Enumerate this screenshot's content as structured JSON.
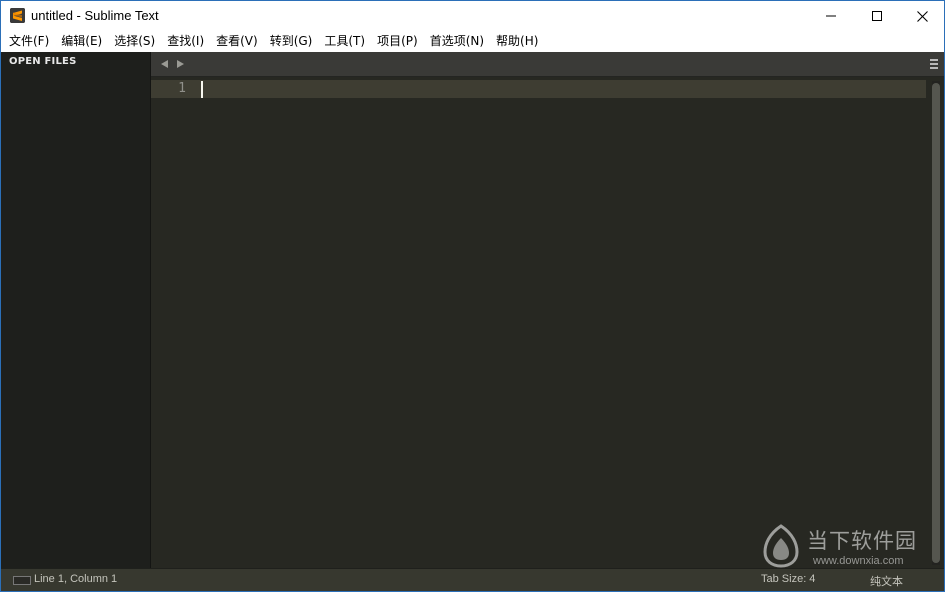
{
  "window": {
    "title": "untitled - Sublime Text",
    "app_icon": "sublime-text-icon",
    "controls": {
      "minimize_icon": "minimize-icon",
      "maximize_icon": "maximize-icon",
      "close_icon": "close-icon"
    }
  },
  "menu": {
    "items": [
      {
        "label": "文件(F)"
      },
      {
        "label": "编辑(E)"
      },
      {
        "label": "选择(S)"
      },
      {
        "label": "查找(I)"
      },
      {
        "label": "查看(V)"
      },
      {
        "label": "转到(G)"
      },
      {
        "label": "工具(T)"
      },
      {
        "label": "项目(P)"
      },
      {
        "label": "首选项(N)"
      },
      {
        "label": "帮助(H)"
      }
    ]
  },
  "sidebar": {
    "heading": "OPEN FILES"
  },
  "tabbar": {
    "prev_icon": "triangle-left-icon",
    "next_icon": "triangle-right-icon",
    "menu_icon": "hamburger-menu-icon"
  },
  "editor": {
    "lines": [
      {
        "number": "1",
        "text": ""
      }
    ]
  },
  "watermark": {
    "title": "当下软件园",
    "url": "www.downxia.com"
  },
  "statusbar": {
    "position": "Line 1, Column 1",
    "tab_size": "Tab Size: 4",
    "syntax": "纯文本"
  },
  "colors": {
    "editor_bg": "#272822",
    "sidebar_bg": "#1e1f1c",
    "tabbar_bg": "#3a3a37",
    "statusbar_bg": "#37382f",
    "current_line": "#3e3d32",
    "line_number": "#90908a",
    "app_icon_accent": "#ff9800"
  }
}
